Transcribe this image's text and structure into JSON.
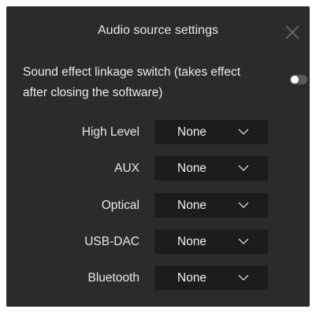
{
  "dialog": {
    "title": "Audio source settings",
    "close_icon": "close-icon"
  },
  "linkage": {
    "text": "Sound effect linkage switch (takes effect after closing the software)",
    "enabled": false
  },
  "sources": [
    {
      "label": "High Level",
      "value": "None"
    },
    {
      "label": "AUX",
      "value": "None"
    },
    {
      "label": "Optical",
      "value": "None"
    },
    {
      "label": "USB-DAC",
      "value": "None"
    },
    {
      "label": "Bluetooth",
      "value": "None"
    }
  ],
  "colors": {
    "dialog_bg": "#2b2b2b",
    "select_bg": "#1c1c1c",
    "text": "#e8e8e8",
    "toggle_track": "#5a5a5a",
    "toggle_knob": "#ffffff"
  }
}
